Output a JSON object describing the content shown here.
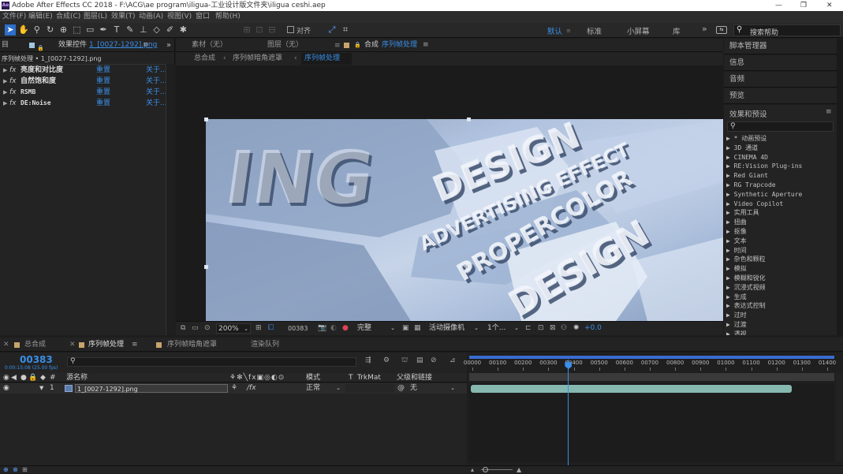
{
  "app_title": "Adobe After Effects CC 2018 - F:\\ACG\\ae program\\iligua-工业设计版文件夹\\iligua ceshi.aep",
  "window_buttons": [
    "—",
    "❐",
    "✕"
  ],
  "menu": [
    "文件(F)",
    "编辑(E)",
    "合成(C)",
    "图层(L)",
    "效果(T)",
    "动画(A)",
    "视图(V)",
    "窗口",
    "帮助(H)"
  ],
  "toolbar": {
    "snap_label": "对齐",
    "workspaces": [
      "默认",
      "标准",
      "小屏幕",
      "库"
    ],
    "more": "»",
    "search_placeholder": "搜索帮助"
  },
  "left_panel": {
    "tab_prefix": "目",
    "tab_title": "效果控件",
    "tab_file": "1_[0027-1292].png",
    "breadcrumb": "序列帧处理 • 1_[0027-1292].png",
    "effects": [
      {
        "name": "亮度和对比度",
        "reset": "重置",
        "about": "关于..."
      },
      {
        "name": "自然饱和度",
        "reset": "重置",
        "about": "关于..."
      },
      {
        "name": "RSMB",
        "reset": "重置",
        "about": "关于..."
      },
      {
        "name": "DE:Noise",
        "reset": "重置",
        "about": "关于..."
      }
    ]
  },
  "viewer": {
    "tabs": [
      "素材（无）",
      "图层（无）"
    ],
    "comp_tab_prefix": "合成",
    "comp_tab_name": "序列帧处理",
    "crumbs": [
      "总合成",
      "序列帧暗角遮罩",
      "序列帧处理"
    ],
    "zoom": "200%",
    "timecode": "00383",
    "quality": "完整",
    "camera": "活动摄像机",
    "views": "1个...",
    "exposure": "+0.0"
  },
  "right_panel": {
    "headers": [
      "脚本管理器",
      "信息",
      "音频",
      "预览"
    ],
    "effects_title": "效果和预设",
    "items": [
      "* 动画预设",
      "3D 通道",
      "CINEMA 4D",
      "RE:Vision Plug-ins",
      "Red Giant",
      "RG Trapcode",
      "Synthetic Aperture",
      "Video Copilot",
      "实用工具",
      "扭曲",
      "抠像",
      "文本",
      "时间",
      "杂色和颗粒",
      "模拟",
      "模糊和锐化",
      "沉浸式视频",
      "生成",
      "表达式控制",
      "过时",
      "过渡",
      "透视"
    ]
  },
  "timeline": {
    "tabs": [
      "总合成",
      "序列帧处理",
      "序列帧暗角遮罩",
      "渲染队列"
    ],
    "active_tab": 1,
    "timecode": "00383",
    "timecode_sub": "0:00:15:08 (25.00 fps)",
    "columns": {
      "num": "#",
      "source": "源名称",
      "mode": "模式",
      "t": "T",
      "trkmat": "TrkMat",
      "parent": "父级和链接"
    },
    "layer": {
      "num": "1",
      "name": "1_[0027-1292].png",
      "mode": "正常",
      "parent": "无"
    },
    "ruler": [
      "00000",
      "00100",
      "00200",
      "00300",
      "00400",
      "00500",
      "00600",
      "00700",
      "00800",
      "00900",
      "01000",
      "01100",
      "01200",
      "01300",
      "01400"
    ],
    "playhead_frame": 383,
    "total_frames": 1420
  },
  "colors": {
    "accent": "#3a8ee6",
    "layer_bar": "#86b8b0",
    "image": "#bdd0ea"
  }
}
